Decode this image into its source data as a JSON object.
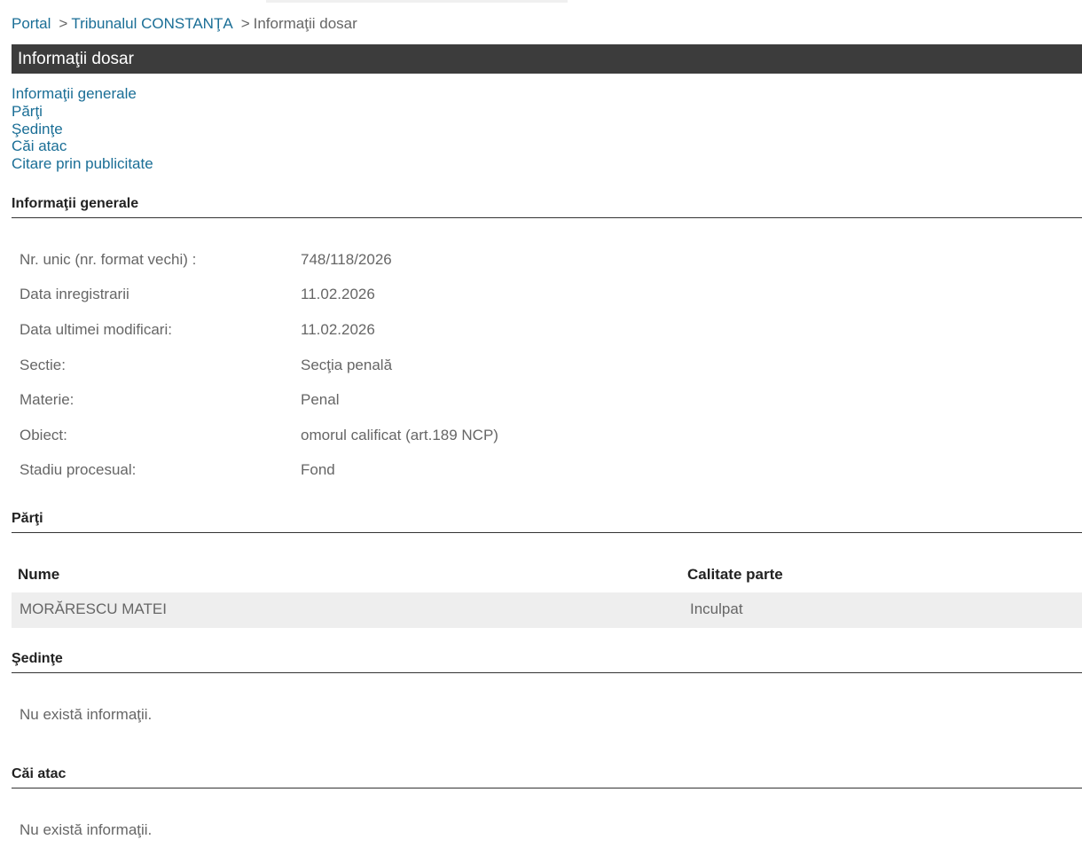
{
  "breadcrumb": {
    "portal": "Portal",
    "court": "Tribunalul CONSTANŢA",
    "current": "Informaţii dosar",
    "separator": ">"
  },
  "title_bar": "Informaţii dosar",
  "toc": [
    "Informaţii generale",
    "Părţi",
    "Şedinţe",
    "Căi atac",
    "Citare prin publicitate"
  ],
  "general": {
    "heading": "Informaţii generale",
    "rows": [
      {
        "label": "Nr. unic (nr. format vechi) :",
        "value": "748/118/2026"
      },
      {
        "label": "Data inregistrarii",
        "value": "11.02.2026"
      },
      {
        "label": "Data ultimei modificari:",
        "value": "11.02.2026"
      },
      {
        "label": "Sectie:",
        "value": "Secţia penală"
      },
      {
        "label": "Materie:",
        "value": "Penal"
      },
      {
        "label": "Obiect:",
        "value": "omorul calificat (art.189 NCP)"
      },
      {
        "label": "Stadiu procesual:",
        "value": "Fond"
      }
    ]
  },
  "parti": {
    "heading": "Părţi",
    "columns": [
      "Nume",
      "Calitate parte"
    ],
    "rows": [
      {
        "name": "MORĂRESCU MATEI",
        "role": "Inculpat"
      }
    ]
  },
  "sedinte": {
    "heading": "Şedinţe",
    "empty": "Nu există informaţii."
  },
  "cai_atac": {
    "heading": "Căi atac",
    "empty": "Nu există informaţii."
  },
  "colors": {
    "link": "#1a6e96",
    "title_bar_bg": "#3c3c3c",
    "row_bg": "#eeeeee",
    "text": "#666666"
  }
}
